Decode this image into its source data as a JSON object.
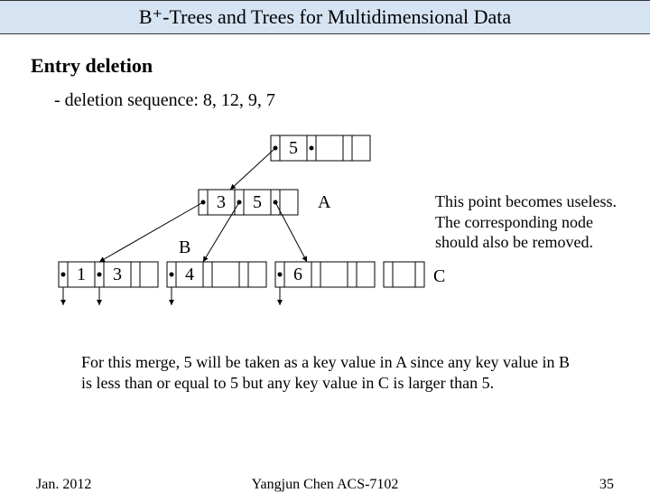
{
  "title": "B⁺-Trees and Trees for Multidimensional Data",
  "heading": "Entry deletion",
  "sequence_line": "- deletion sequence: 8, 12, 9, 7",
  "labels": {
    "A": "A",
    "B": "B",
    "C": "C"
  },
  "annotation": "This point becomes useless. The corresponding node should also be removed.",
  "paragraph": "For this merge, 5 will be taken as a key value in A since any key value in B is less than or equal to 5 but any key value in C is larger than 5.",
  "tree": {
    "root": {
      "keys": [
        "5",
        "",
        ""
      ]
    },
    "mid": {
      "keys": [
        "3",
        "5",
        ""
      ]
    },
    "leaves": [
      {
        "keys": [
          "1",
          "3",
          ""
        ]
      },
      {
        "keys": [
          "4",
          "",
          ""
        ]
      },
      {
        "keys": [
          "6",
          "",
          ""
        ]
      },
      {
        "keys": [
          "",
          "",
          ""
        ]
      }
    ]
  },
  "footer": {
    "left": "Jan. 2012",
    "center": "Yangjun Chen     ACS-7102",
    "right": "35"
  }
}
